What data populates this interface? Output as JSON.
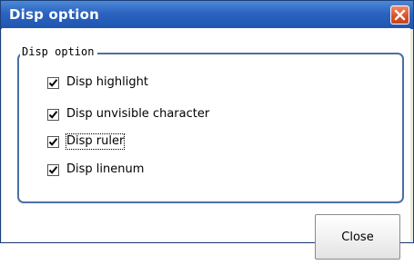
{
  "window": {
    "title": "Disp option"
  },
  "group": {
    "legend": "Disp option"
  },
  "options": [
    {
      "label": "Disp highlight",
      "checked": true
    },
    {
      "label": "Disp unvisible character",
      "checked": true
    },
    {
      "label": "Disp ruler",
      "checked": true
    },
    {
      "label": "Disp linenum",
      "checked": true
    }
  ],
  "buttons": {
    "close_label": "Close"
  },
  "icons": {
    "title_close": "close-icon",
    "check": "check-icon"
  },
  "colors": {
    "titlebar": "#2a63bf",
    "close_x": "#d9532c",
    "groupbox_border": "#4a6fa5"
  }
}
